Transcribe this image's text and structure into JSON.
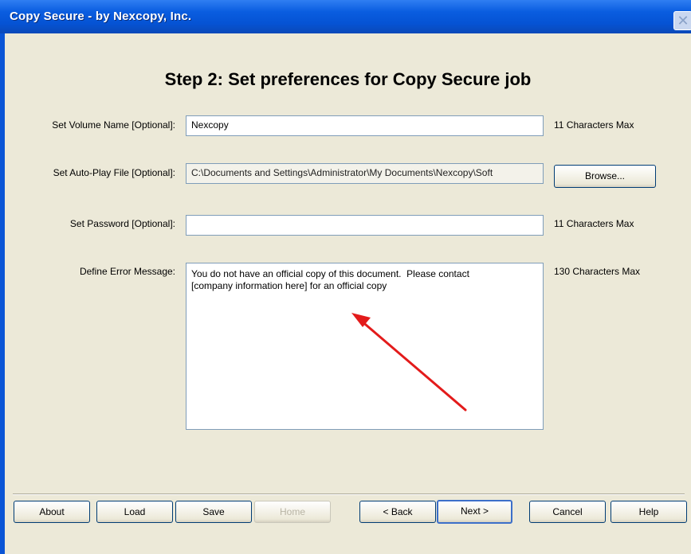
{
  "window": {
    "title": "Copy Secure - by Nexcopy, Inc.",
    "close_glyph": "✕"
  },
  "step_title": "Step 2: Set preferences for Copy Secure job",
  "form": {
    "volume_name": {
      "label": "Set Volume Name [Optional]:",
      "value": "Nexcopy",
      "hint": "11 Characters Max"
    },
    "autoplay": {
      "label": "Set Auto-Play File [Optional]:",
      "value": "C:\\Documents and Settings\\Administrator\\My Documents\\Nexcopy\\Soft",
      "browse_label": "Browse..."
    },
    "password": {
      "label": "Set Password [Optional]:",
      "value": "",
      "hint": "11 Characters Max"
    },
    "error_message": {
      "label": "Define Error Message:",
      "value": "You do not have an official copy of this document.  Please contact\n[company information here] for an official copy",
      "hint": "130 Characters Max"
    }
  },
  "annotation": {
    "arrow_color": "#e31b1b",
    "arrow_icon": "red-annotation-arrow"
  },
  "buttons": {
    "about": "About",
    "load": "Load",
    "save": "Save",
    "home": "Home",
    "back": "< Back",
    "next": "Next >",
    "cancel": "Cancel",
    "help": "Help"
  }
}
